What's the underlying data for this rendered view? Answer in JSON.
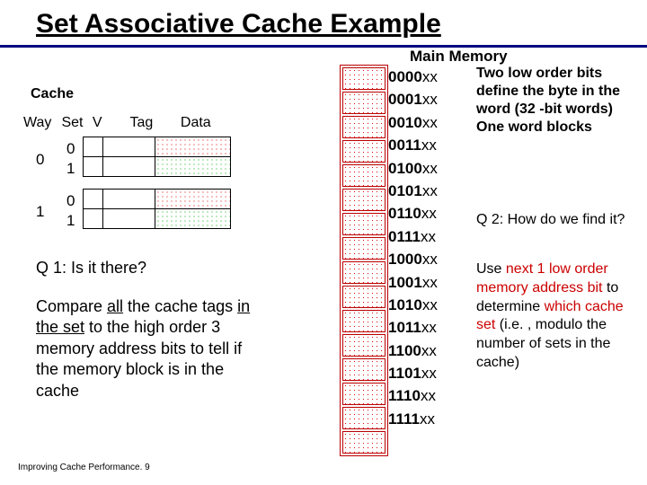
{
  "title": "Set Associative Cache Example",
  "cache_label": "Cache",
  "headers": {
    "way": "Way",
    "set": "Set",
    "v": "V",
    "tag": "Tag",
    "data": "Data"
  },
  "ways": [
    "0",
    "1"
  ],
  "sets_per_way": [
    "0",
    "1"
  ],
  "q1": "Q 1: Is it there?",
  "q1_body_pre": "Compare ",
  "q1_body_all": "all",
  "q1_body_mid": " the cache tags ",
  "q1_body_inset": "in the set",
  "q1_body_post": " to the high order 3 memory address bits to tell if the memory block is in the cache",
  "footer": "Improving Cache Performance. 9",
  "mm_title": "Main Memory",
  "mm_addrs": [
    "0000",
    "0001",
    "0010",
    "0011",
    "0100",
    "0101",
    "0110",
    "0111",
    "1000",
    "1001",
    "1010",
    "1011",
    "1100",
    "1101",
    "1110",
    "1111"
  ],
  "mm_suffix": "xx",
  "right1": "Two low order bits define the byte in the word (32 -bit words)\nOne word blocks",
  "q2": "Q 2: How do we find it?",
  "right2_pre": "Use ",
  "right2_red1": "next 1 low order memory address bit",
  "right2_mid": " to determine ",
  "right2_red2": "which cache set",
  "right2_post": " (i.e. , modulo the number of sets in the cache)",
  "chart_data": {
    "type": "table",
    "title": "Set Associative Cache vs Main Memory mapping",
    "cache_ways": 2,
    "sets_per_way": 2,
    "columns": [
      "V",
      "Tag",
      "Data"
    ],
    "main_memory_blocks": 16,
    "address_format": "4-bit block index + 2-bit byte offset (xx)",
    "set_index_bits": 1,
    "tag_bits": 3
  }
}
